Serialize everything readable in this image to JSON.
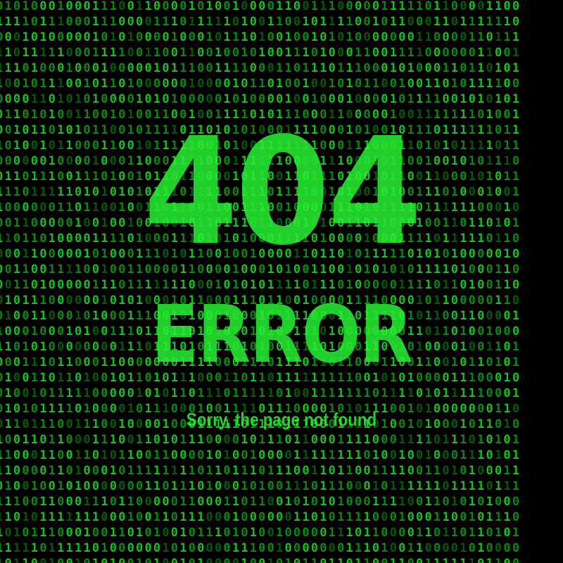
{
  "error": {
    "code": "404",
    "title": "ERROR",
    "message": "Sorry, the page not found"
  },
  "colors": {
    "background": "#000000",
    "binary_bright": "#18c020",
    "binary_mid": "#0a8a12",
    "binary_dim": "#055a0a",
    "headline": "#28f032"
  }
}
